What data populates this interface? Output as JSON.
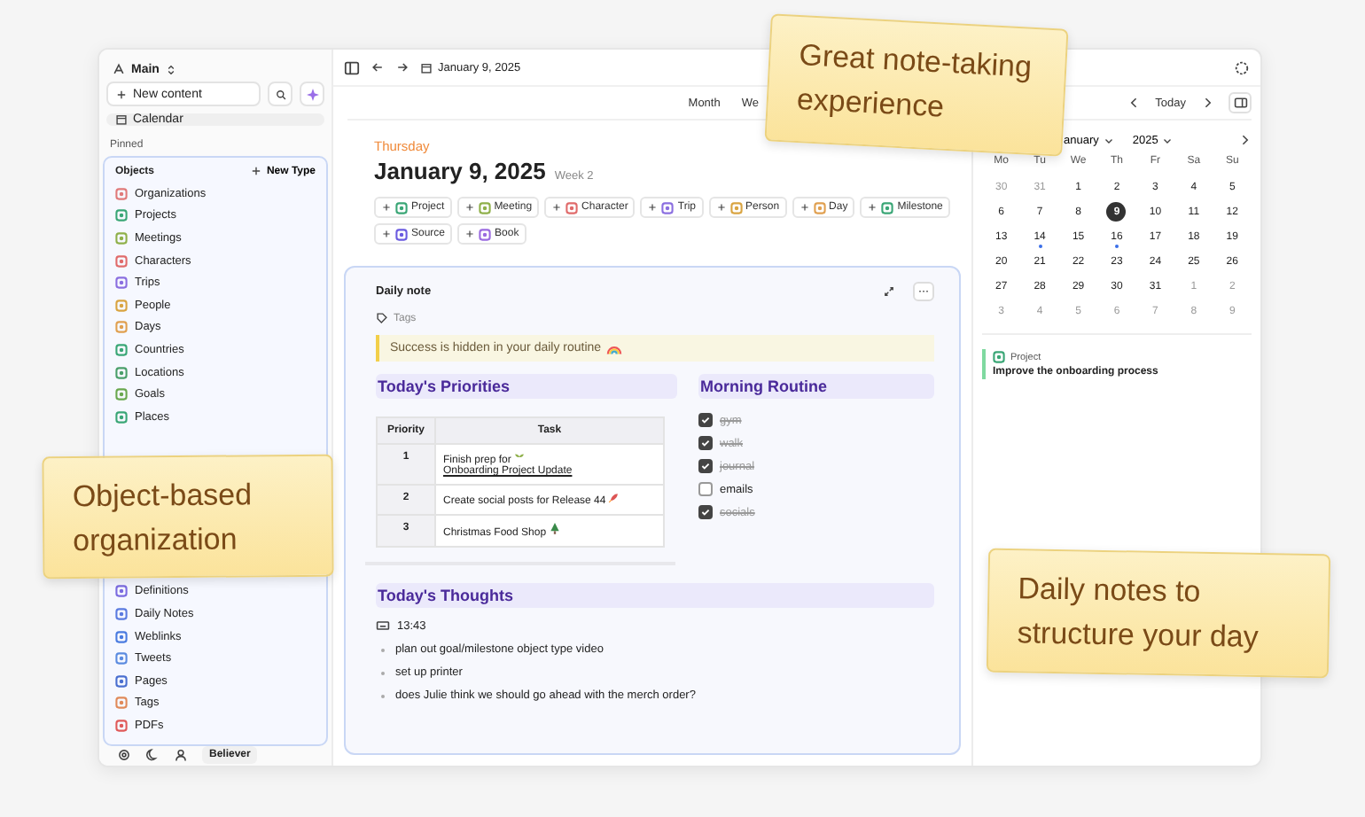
{
  "sidebar": {
    "workspace": "Main",
    "new_content": "New content",
    "calendar": "Calendar",
    "pinned": "Pinned",
    "objects_title": "Objects",
    "new_type": "New Type",
    "objects": [
      {
        "label": "Organizations",
        "color": "#e07a7a"
      },
      {
        "label": "Projects",
        "color": "#3aa676"
      },
      {
        "label": "Meetings",
        "color": "#8fb04a"
      },
      {
        "label": "Characters",
        "color": "#e06b6b"
      },
      {
        "label": "Trips",
        "color": "#8b6fe0"
      },
      {
        "label": "People",
        "color": "#d9a441"
      },
      {
        "label": "Days",
        "color": "#e0a050"
      },
      {
        "label": "Countries",
        "color": "#3aa676"
      },
      {
        "label": "Locations",
        "color": "#4a9f6a"
      },
      {
        "label": "Goals",
        "color": "#6aa84f"
      },
      {
        "label": "Places",
        "color": "#3aa676"
      }
    ],
    "objects_lower": [
      {
        "label": "Definitions",
        "color": "#7b6be0"
      },
      {
        "label": "Daily Notes",
        "color": "#5b7be0"
      },
      {
        "label": "Weblinks",
        "color": "#4a7be0"
      },
      {
        "label": "Tweets",
        "color": "#5b8be0"
      },
      {
        "label": "Pages",
        "color": "#4a6fd0"
      },
      {
        "label": "Tags",
        "color": "#e08a5a"
      },
      {
        "label": "PDFs",
        "color": "#e05a5a"
      }
    ],
    "user": "Believer"
  },
  "toolbar": {
    "date": "January 9, 2025"
  },
  "view_tabs": [
    "Month",
    "We"
  ],
  "day": {
    "weekday": "Thursday",
    "date": "January 9, 2025",
    "week": "Week 2"
  },
  "quick_add": [
    {
      "label": "Project",
      "color": "#3aa676"
    },
    {
      "label": "Meeting",
      "color": "#8fb04a"
    },
    {
      "label": "Character",
      "color": "#e06b6b"
    },
    {
      "label": "Trip",
      "color": "#8b6fe0"
    },
    {
      "label": "Person",
      "color": "#d9a441"
    },
    {
      "label": "Day",
      "color": "#e0a050"
    },
    {
      "label": "Milestone",
      "color": "#3aa676"
    },
    {
      "label": "Source",
      "color": "#6b5be0"
    },
    {
      "label": "Book",
      "color": "#9b6be0"
    }
  ],
  "note": {
    "title": "Daily note",
    "more": "···",
    "tags": "Tags",
    "quote": "Success is hidden in your daily routine",
    "priorities": {
      "heading": "Today's Priorities",
      "columns": [
        "Priority",
        "Task"
      ],
      "rows": [
        {
          "priority": "1",
          "task": "Finish prep for",
          "link": "Onboarding Project Update"
        },
        {
          "priority": "2",
          "task": "Create social posts for Release 44"
        },
        {
          "priority": "3",
          "task": "Christmas Food Shop"
        }
      ]
    },
    "routine": {
      "heading": "Morning Routine",
      "items": [
        {
          "label": "gym",
          "checked": true
        },
        {
          "label": "walk",
          "checked": true
        },
        {
          "label": "journal",
          "checked": true
        },
        {
          "label": "emails",
          "checked": false
        },
        {
          "label": "socials",
          "checked": true
        }
      ]
    },
    "thoughts": {
      "heading": "Today's Thoughts",
      "time": "13:43",
      "bullets": [
        "plan out goal/milestone object type video",
        "set up printer",
        "does Julie think we should go ahead with the merch order?"
      ]
    }
  },
  "calendar": {
    "today": "Today",
    "month": "anuary",
    "year": "2025",
    "weekdays": [
      "Mo",
      "Tu",
      "We",
      "Th",
      "Fr",
      "Sa",
      "Su"
    ],
    "days": [
      {
        "label": "30",
        "muted": true,
        "selected": false,
        "dot": false
      },
      {
        "label": "31",
        "muted": true,
        "selected": false,
        "dot": false
      },
      {
        "label": "1",
        "muted": false,
        "selected": false,
        "dot": false
      },
      {
        "label": "2",
        "muted": false,
        "selected": false,
        "dot": false
      },
      {
        "label": "3",
        "muted": false,
        "selected": false,
        "dot": false
      },
      {
        "label": "4",
        "muted": false,
        "selected": false,
        "dot": false
      },
      {
        "label": "5",
        "muted": false,
        "selected": false,
        "dot": false
      },
      {
        "label": "6",
        "muted": false,
        "selected": false,
        "dot": false
      },
      {
        "label": "7",
        "muted": false,
        "selected": false,
        "dot": false
      },
      {
        "label": "8",
        "muted": false,
        "selected": false,
        "dot": false
      },
      {
        "label": "9",
        "muted": false,
        "selected": true,
        "dot": false
      },
      {
        "label": "10",
        "muted": false,
        "selected": false,
        "dot": false
      },
      {
        "label": "11",
        "muted": false,
        "selected": false,
        "dot": false
      },
      {
        "label": "12",
        "muted": false,
        "selected": false,
        "dot": false
      },
      {
        "label": "13",
        "muted": false,
        "selected": false,
        "dot": false
      },
      {
        "label": "14",
        "muted": false,
        "selected": false,
        "dot": true
      },
      {
        "label": "15",
        "muted": false,
        "selected": false,
        "dot": false
      },
      {
        "label": "16",
        "muted": false,
        "selected": false,
        "dot": true
      },
      {
        "label": "17",
        "muted": false,
        "selected": false,
        "dot": false
      },
      {
        "label": "18",
        "muted": false,
        "selected": false,
        "dot": false
      },
      {
        "label": "19",
        "muted": false,
        "selected": false,
        "dot": false
      },
      {
        "label": "20",
        "muted": false,
        "selected": false,
        "dot": false
      },
      {
        "label": "21",
        "muted": false,
        "selected": false,
        "dot": false
      },
      {
        "label": "22",
        "muted": false,
        "selected": false,
        "dot": false
      },
      {
        "label": "23",
        "muted": false,
        "selected": false,
        "dot": false
      },
      {
        "label": "24",
        "muted": false,
        "selected": false,
        "dot": false
      },
      {
        "label": "25",
        "muted": false,
        "selected": false,
        "dot": false
      },
      {
        "label": "26",
        "muted": false,
        "selected": false,
        "dot": false
      },
      {
        "label": "27",
        "muted": false,
        "selected": false,
        "dot": false
      },
      {
        "label": "28",
        "muted": false,
        "selected": false,
        "dot": false
      },
      {
        "label": "29",
        "muted": false,
        "selected": false,
        "dot": false
      },
      {
        "label": "30",
        "muted": false,
        "selected": false,
        "dot": false
      },
      {
        "label": "31",
        "muted": false,
        "selected": false,
        "dot": false
      },
      {
        "label": "1",
        "muted": true,
        "selected": false,
        "dot": false
      },
      {
        "label": "2",
        "muted": true,
        "selected": false,
        "dot": false
      },
      {
        "label": "3",
        "muted": true,
        "selected": false,
        "dot": false
      },
      {
        "label": "4",
        "muted": true,
        "selected": false,
        "dot": false
      },
      {
        "label": "5",
        "muted": true,
        "selected": false,
        "dot": false
      },
      {
        "label": "6",
        "muted": true,
        "selected": false,
        "dot": false
      },
      {
        "label": "7",
        "muted": true,
        "selected": false,
        "dot": false
      },
      {
        "label": "8",
        "muted": true,
        "selected": false,
        "dot": false
      },
      {
        "label": "9",
        "muted": true,
        "selected": false,
        "dot": false
      }
    ],
    "event": {
      "type": "Project",
      "title": "Improve the onboarding process"
    }
  },
  "callouts": [
    "Great note-taking experience",
    "Object-based organization",
    "Daily notes to structure your day"
  ]
}
